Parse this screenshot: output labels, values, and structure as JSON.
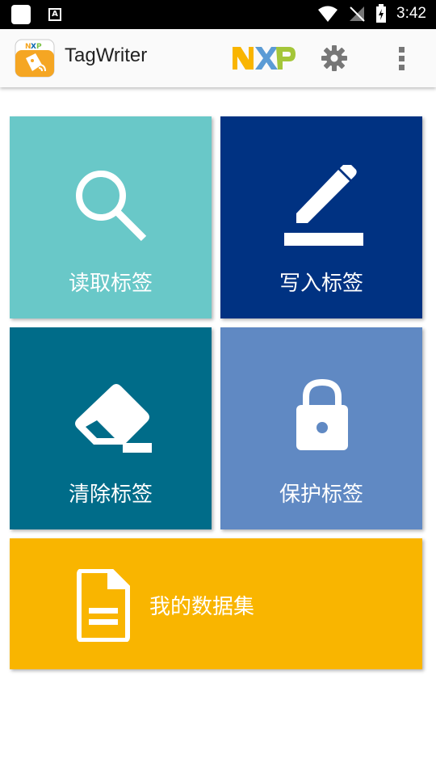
{
  "status_bar": {
    "time": "3:42"
  },
  "app_bar": {
    "title": "TagWriter",
    "logo_text": "NXP",
    "actions": [
      "gear-icon",
      "overflow-menu-icon"
    ]
  },
  "tiles": [
    {
      "label": "读取标签",
      "icon": "search-icon",
      "color": "#69c8c8"
    },
    {
      "label": "写入标签",
      "icon": "pencil-icon",
      "color": "#003282"
    },
    {
      "label": "清除标签",
      "icon": "eraser-icon",
      "color": "#006c89"
    },
    {
      "label": "保护标签",
      "icon": "lock-icon",
      "color": "#6089c3"
    },
    {
      "label": "我的数据集",
      "icon": "document-icon",
      "color": "#f9b500"
    }
  ]
}
